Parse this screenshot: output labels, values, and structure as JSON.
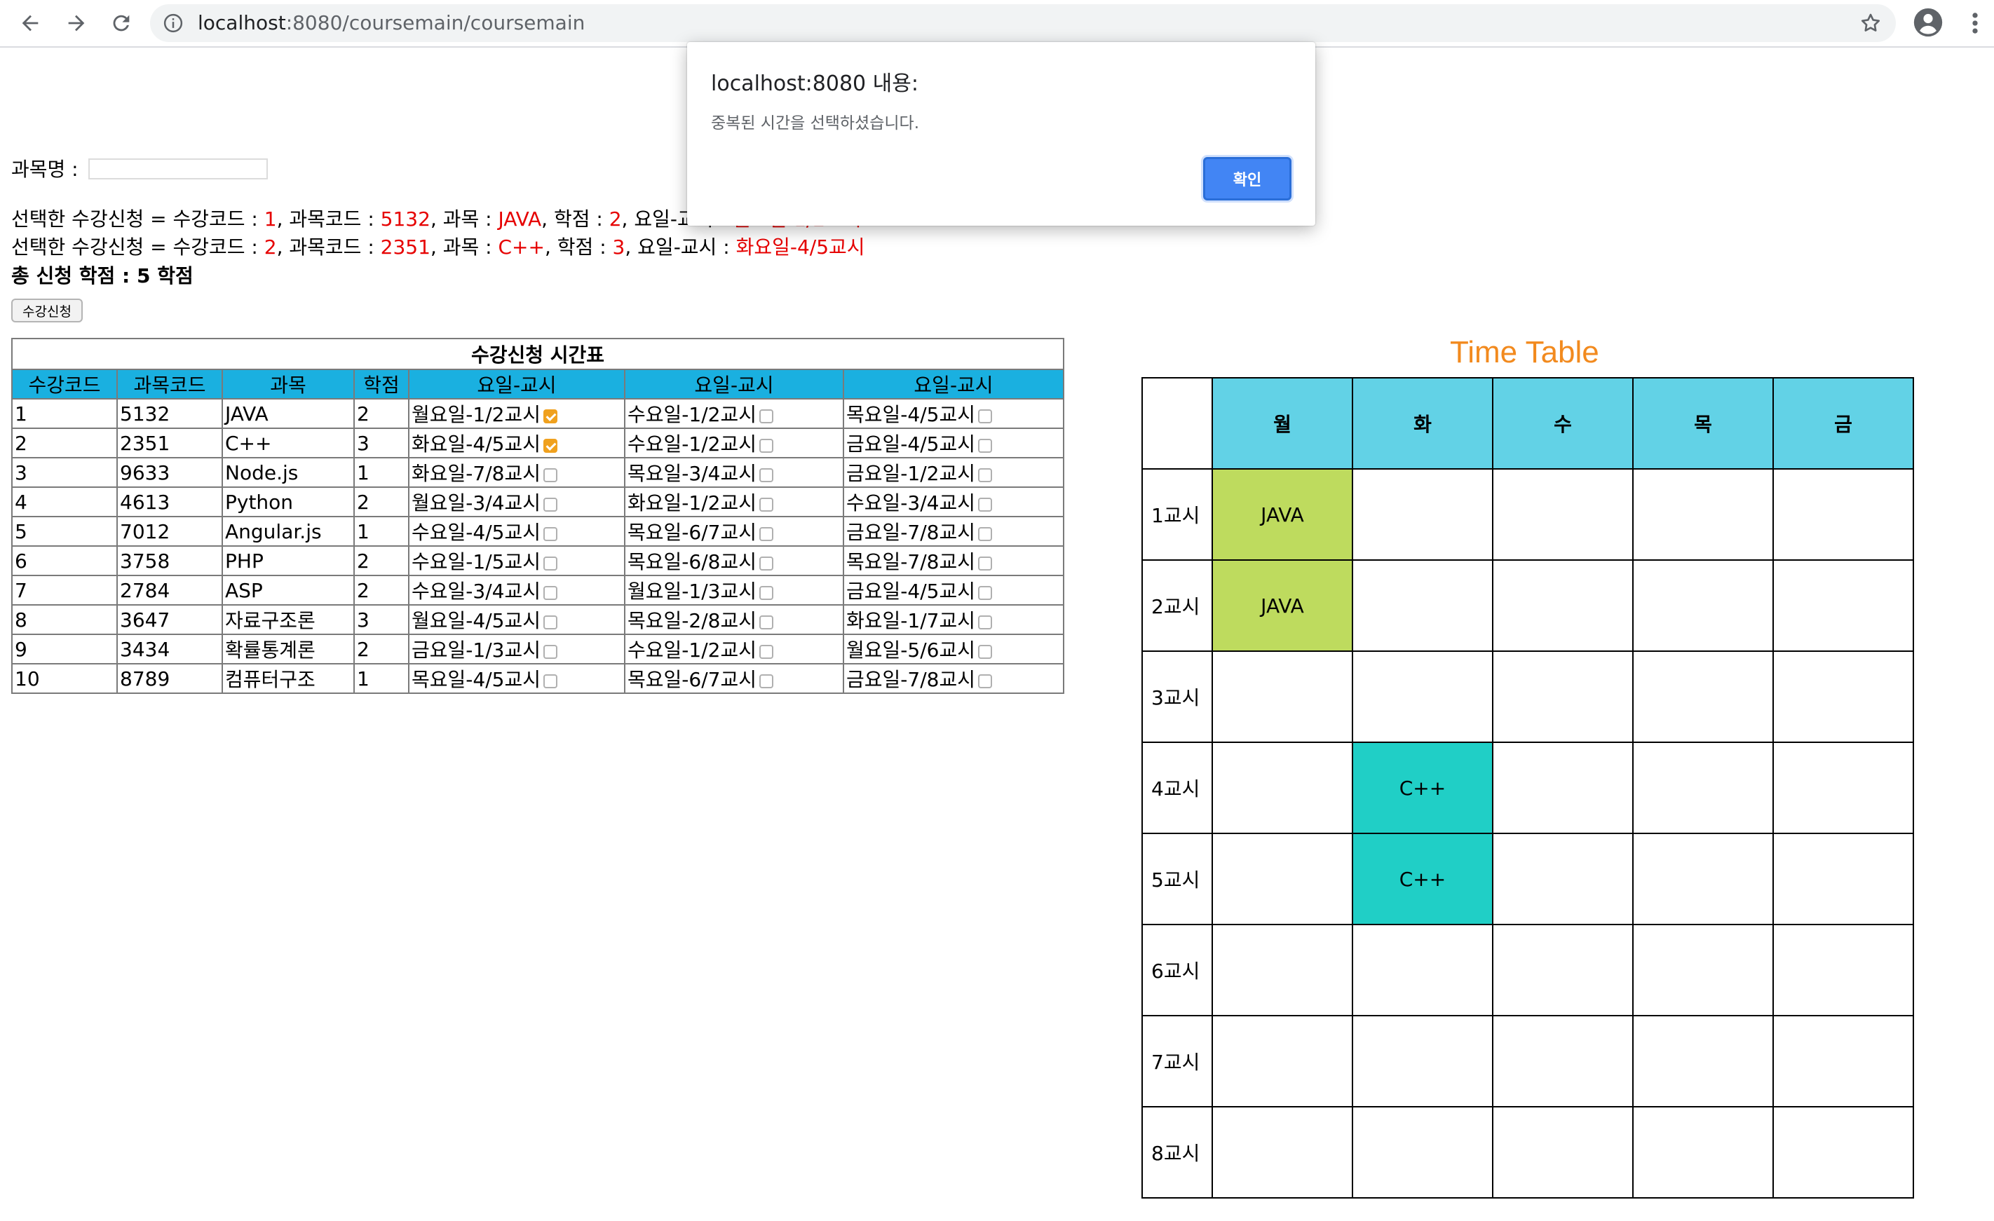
{
  "browser": {
    "url_host": "localhost",
    "url_path": ":8080/coursemain/coursemain"
  },
  "search": {
    "label": "과목명 :",
    "value": ""
  },
  "selected": [
    {
      "prefix": "선택한 수강신청 = 수강코드 : ",
      "code": "1",
      "l_subject_code": ", 과목코드 : ",
      "subject_code": "5132",
      "l_subject": ", 과목 : ",
      "subject": "JAVA",
      "l_credit": ", 학점 : ",
      "credit": "2",
      "l_time": ", 요일-교시 : ",
      "time": "월요일-1/2교시"
    },
    {
      "prefix": "선택한 수강신청 = 수강코드 : ",
      "code": "2",
      "l_subject_code": ", 과목코드 : ",
      "subject_code": "2351",
      "l_subject": ", 과목 : ",
      "subject": "C++",
      "l_credit": ", 학점 : ",
      "credit": "3",
      "l_time": ", 요일-교시 : ",
      "time": "화요일-4/5교시"
    }
  ],
  "total_credits": "총 신청 학점 : 5 학점",
  "apply_button": "수강신청",
  "course_table": {
    "caption": "수강신청 시간표",
    "headers": [
      "수강코드",
      "과목코드",
      "과목",
      "학점",
      "요일-교시",
      "요일-교시",
      "요일-교시"
    ],
    "rows": [
      {
        "code": "1",
        "subject_code": "5132",
        "subject": "JAVA",
        "credit": "2",
        "t1": "월요일-1/2교시",
        "t1c": true,
        "t2": "수요일-1/2교시",
        "t2c": false,
        "t3": "목요일-4/5교시",
        "t3c": false
      },
      {
        "code": "2",
        "subject_code": "2351",
        "subject": "C++",
        "credit": "3",
        "t1": "화요일-4/5교시",
        "t1c": true,
        "t2": "수요일-1/2교시",
        "t2c": false,
        "t3": "금요일-4/5교시",
        "t3c": false
      },
      {
        "code": "3",
        "subject_code": "9633",
        "subject": "Node.js",
        "credit": "1",
        "t1": "화요일-7/8교시",
        "t1c": false,
        "t2": "목요일-3/4교시",
        "t2c": false,
        "t3": "금요일-1/2교시",
        "t3c": false
      },
      {
        "code": "4",
        "subject_code": "4613",
        "subject": "Python",
        "credit": "2",
        "t1": "월요일-3/4교시",
        "t1c": false,
        "t2": "화요일-1/2교시",
        "t2c": false,
        "t3": "수요일-3/4교시",
        "t3c": false
      },
      {
        "code": "5",
        "subject_code": "7012",
        "subject": "Angular.js",
        "credit": "1",
        "t1": "수요일-4/5교시",
        "t1c": false,
        "t2": "목요일-6/7교시",
        "t2c": false,
        "t3": "금요일-7/8교시",
        "t3c": false
      },
      {
        "code": "6",
        "subject_code": "3758",
        "subject": "PHP",
        "credit": "2",
        "t1": "수요일-1/5교시",
        "t1c": false,
        "t2": "목요일-6/8교시",
        "t2c": false,
        "t3": "목요일-7/8교시",
        "t3c": false
      },
      {
        "code": "7",
        "subject_code": "2784",
        "subject": "ASP",
        "credit": "2",
        "t1": "수요일-3/4교시",
        "t1c": false,
        "t2": "월요일-1/3교시",
        "t2c": false,
        "t3": "금요일-4/5교시",
        "t3c": false
      },
      {
        "code": "8",
        "subject_code": "3647",
        "subject": "자료구조론",
        "credit": "3",
        "t1": "월요일-4/5교시",
        "t1c": false,
        "t2": "목요일-2/8교시",
        "t2c": false,
        "t3": "화요일-1/7교시",
        "t3c": false
      },
      {
        "code": "9",
        "subject_code": "3434",
        "subject": "확률통계론",
        "credit": "2",
        "t1": "금요일-1/3교시",
        "t1c": false,
        "t2": "수요일-1/2교시",
        "t2c": false,
        "t3": "월요일-5/6교시",
        "t3c": false
      },
      {
        "code": "10",
        "subject_code": "8789",
        "subject": "컴퓨터구조",
        "credit": "1",
        "t1": "목요일-4/5교시",
        "t1c": false,
        "t2": "목요일-6/7교시",
        "t2c": false,
        "t3": "금요일-7/8교시",
        "t3c": false
      }
    ]
  },
  "time_table": {
    "title": "Time Table",
    "days": [
      "월",
      "화",
      "수",
      "목",
      "금"
    ],
    "periods": [
      "1교시",
      "2교시",
      "3교시",
      "4교시",
      "5교시",
      "6교시",
      "7교시",
      "8교시"
    ],
    "cells": [
      [
        "JAVA",
        "",
        "",
        "",
        ""
      ],
      [
        "JAVA",
        "",
        "",
        "",
        ""
      ],
      [
        "",
        "",
        "",
        "",
        ""
      ],
      [
        "",
        "C++",
        "",
        "",
        ""
      ],
      [
        "",
        "C++",
        "",
        "",
        ""
      ],
      [
        "",
        "",
        "",
        "",
        ""
      ],
      [
        "",
        "",
        "",
        "",
        ""
      ],
      [
        "",
        "",
        "",
        "",
        ""
      ]
    ],
    "colors": {
      "JAVA": "#bedb5e",
      "C++": "#20cfc6",
      "header": "#62d2e6"
    }
  },
  "dialog": {
    "title": "localhost:8080 내용:",
    "message": "중복된 시간을 선택하셨습니다.",
    "ok_label": "확인"
  }
}
